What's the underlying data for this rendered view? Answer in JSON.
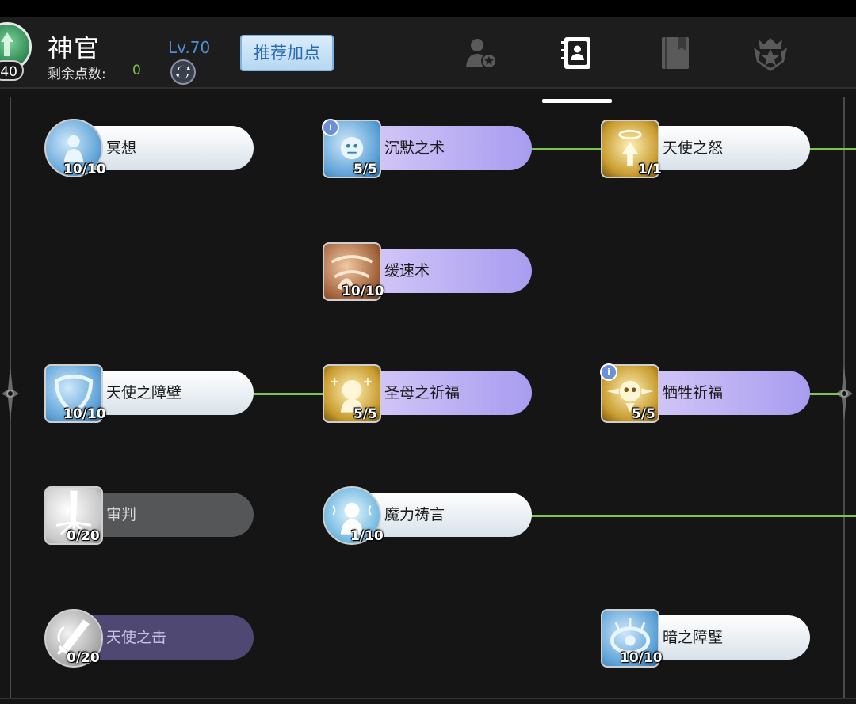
{
  "header": {
    "class_name": "神官",
    "avatar_badge": "40",
    "points_label": "剩余点数:",
    "points_value": "0",
    "level": "Lv.70",
    "recommend_button": "推荐加点",
    "reset_icon": "refresh-icon",
    "tabs": [
      {
        "name": "character-star-icon",
        "active": false
      },
      {
        "name": "skill-book-icon",
        "active": true
      },
      {
        "name": "bookmark-book-icon",
        "active": false
      },
      {
        "name": "crown-emblem-icon",
        "active": false
      }
    ]
  },
  "colors": {
    "accent_green": "#7cc54a",
    "level_blue": "#4f8fd6",
    "pill_purple": "#a89cf0",
    "pill_white": "#d8e2ea"
  },
  "skills": [
    {
      "id": "meditation",
      "name": "冥想",
      "level": "10/10",
      "icon": "meditation-icon"
    },
    {
      "id": "silence",
      "name": "沉默之术",
      "level": "5/5",
      "icon": "silence-icon",
      "info": "i"
    },
    {
      "id": "angel-wrath",
      "name": "天使之怒",
      "level": "1/1",
      "icon": "angel-wrath-icon"
    },
    {
      "id": "slow",
      "name": "缓速术",
      "level": "10/10",
      "icon": "chain-slow-icon"
    },
    {
      "id": "angel-barrier",
      "name": "天使之障壁",
      "level": "10/10",
      "icon": "angel-barrier-icon"
    },
    {
      "id": "madonna-blessing",
      "name": "圣母之祈福",
      "level": "5/5",
      "icon": "madonna-icon"
    },
    {
      "id": "sacrifice-blessing",
      "name": "牺牲祈福",
      "level": "5/5",
      "icon": "sacrifice-icon",
      "info": "i"
    },
    {
      "id": "judgment",
      "name": "审判",
      "level": "0/20",
      "icon": "judgment-icon"
    },
    {
      "id": "magic-prayer",
      "name": "魔力祷言",
      "level": "1/10",
      "icon": "prayer-icon"
    },
    {
      "id": "angel-strike",
      "name": "天使之击",
      "level": "0/20",
      "icon": "angel-strike-icon"
    },
    {
      "id": "dark-barrier",
      "name": "暗之障壁",
      "level": "10/10",
      "icon": "dark-barrier-icon"
    }
  ]
}
